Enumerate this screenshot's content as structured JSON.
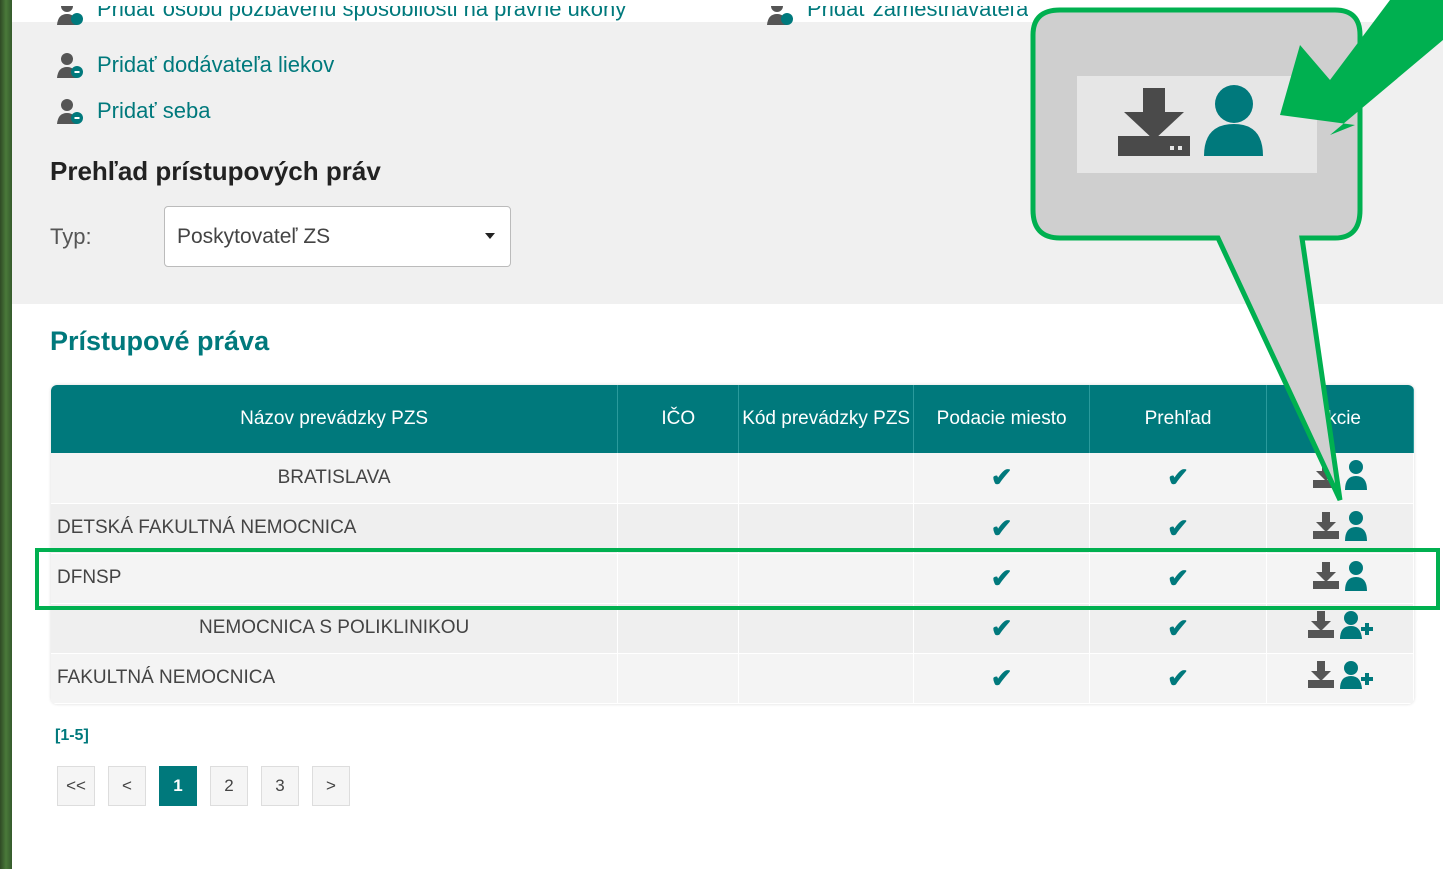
{
  "links": {
    "add_incapacitated": "Pridať osobu pozbavenú spôsobilosti na právne úkony",
    "add_employer": "Pridať zamestnávateľa",
    "add_drug_supplier": "Pridať dodávateľa liekov",
    "add_self": "Pridať seba"
  },
  "overview": {
    "title": "Prehľad prístupových práv",
    "type_label": "Typ:",
    "type_value": "Poskytovateľ ZS"
  },
  "access": {
    "title": "Prístupové práva",
    "columns": [
      "Názov prevádzky PZS",
      "IČO",
      "Kód prevádzky PZS",
      "Podacie miesto",
      "Prehľad",
      "Akcie"
    ],
    "header_visible": [
      "Názov prevádzky PZS",
      "IČO",
      "Kód prevádzky PZS",
      "Podacie miesto",
      "Prehľad",
      "kcie"
    ],
    "rows": [
      {
        "name": "BRATISLAVA",
        "align": "center",
        "person_type": "person"
      },
      {
        "name": "DETSKÁ FAKULTNÁ NEMOCNICA",
        "align": "left",
        "person_type": "person"
      },
      {
        "name": "DFNSP",
        "align": "left",
        "person_type": "person"
      },
      {
        "name": "NEMOCNICA S POLIKLINIKOU",
        "align": "center",
        "person_type": "person-add"
      },
      {
        "name": "FAKULTNÁ NEMOCNICA",
        "align": "left",
        "person_type": "person-add"
      }
    ]
  },
  "pagination": {
    "range": "[1-5]",
    "buttons": [
      "<<",
      "<",
      "1",
      "2",
      "3",
      ">"
    ],
    "active": "1"
  },
  "colors": {
    "accent": "#00797c",
    "highlight": "#00b050",
    "icon_gray": "#555555"
  }
}
